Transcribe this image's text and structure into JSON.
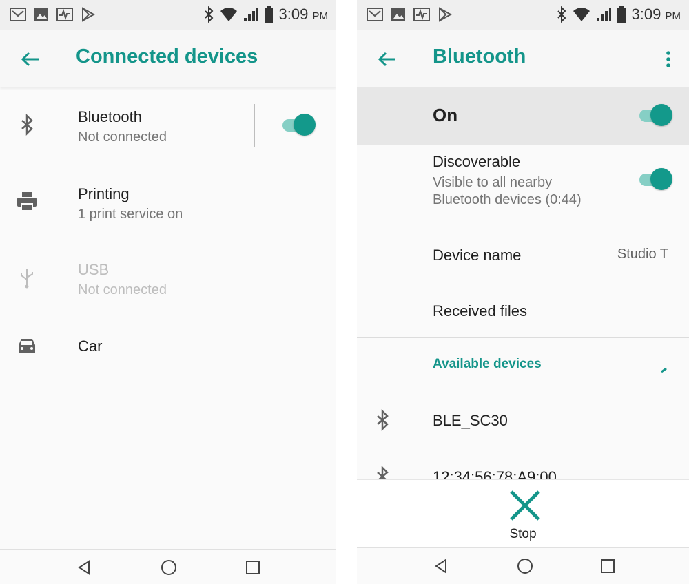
{
  "status_bar": {
    "time": "3:09",
    "ampm": "PM"
  },
  "left": {
    "title": "Connected devices",
    "items": [
      {
        "title": "Bluetooth",
        "subtitle": "Not connected"
      },
      {
        "title": "Printing",
        "subtitle": "1 print service on"
      },
      {
        "title": "USB",
        "subtitle": "Not connected"
      },
      {
        "title": "Car",
        "subtitle": ""
      }
    ]
  },
  "right": {
    "title": "Bluetooth",
    "on_label": "On",
    "discoverable": {
      "title": "Discoverable",
      "line1": "Visible to all nearby",
      "line2": "Bluetooth devices (0:44)"
    },
    "device_name": {
      "label": "Device name",
      "value": "Studio T"
    },
    "received_files": "Received files",
    "available_devices": "Available devices",
    "devices": [
      "BLE_SC30",
      "12:34:56:78:A9:00"
    ],
    "stop_label": "Stop"
  },
  "colors": {
    "accent": "#14958a",
    "switch_track": "#86cfc5",
    "switch_thumb": "#13998b"
  },
  "icons": {
    "left": [
      "back-arrow-icon",
      "bluetooth-icon",
      "printer-icon",
      "usb-icon",
      "car-icon"
    ],
    "right": [
      "back-arrow-icon",
      "more-vert-icon",
      "bluetooth-icon",
      "close-icon"
    ],
    "nav": [
      "back-triangle-icon",
      "home-circle-icon",
      "recents-square-icon"
    ]
  }
}
